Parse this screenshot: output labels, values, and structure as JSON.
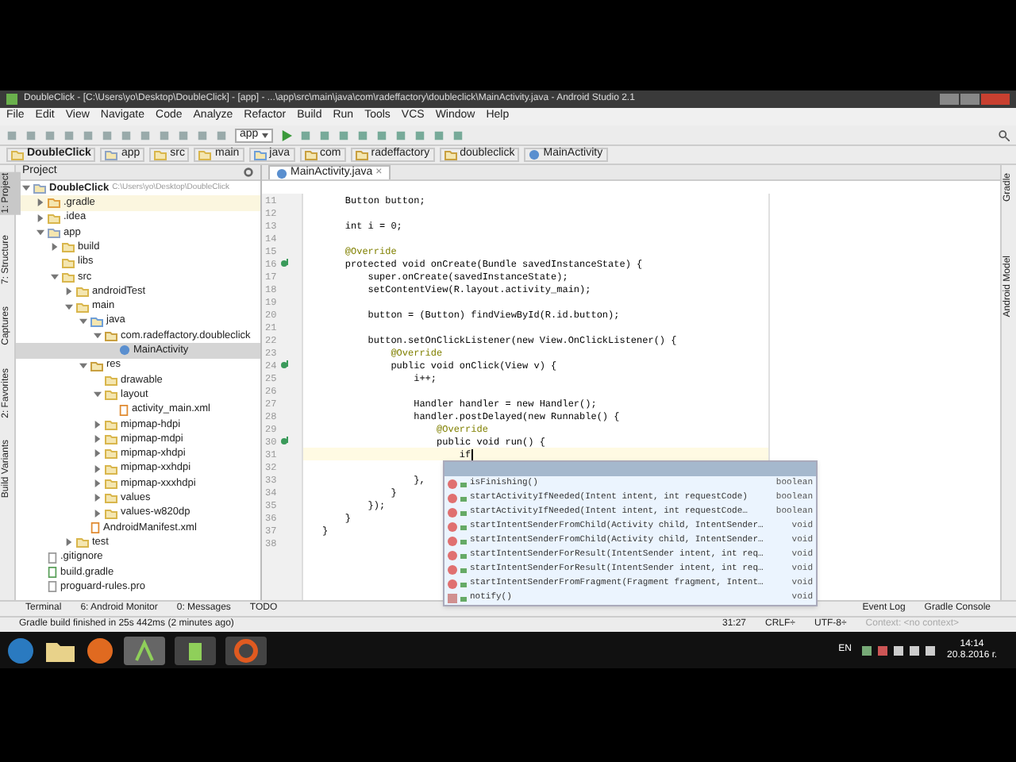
{
  "window": {
    "title": "DoubleClick - [C:\\Users\\yo\\Desktop\\DoubleClick] - [app] - ...\\app\\src\\main\\java\\com\\radeffactory\\doubleclick\\MainActivity.java - Android Studio 2.1"
  },
  "menu": [
    "File",
    "Edit",
    "View",
    "Navigate",
    "Code",
    "Analyze",
    "Refactor",
    "Build",
    "Run",
    "Tools",
    "VCS",
    "Window",
    "Help"
  ],
  "toolbar": {
    "run_config": "app"
  },
  "breadcrumbs": [
    {
      "label": "DoubleClick",
      "kind": "project"
    },
    {
      "label": "app",
      "kind": "module"
    },
    {
      "label": "src",
      "kind": "folder"
    },
    {
      "label": "main",
      "kind": "folder"
    },
    {
      "label": "java",
      "kind": "source"
    },
    {
      "label": "com",
      "kind": "package"
    },
    {
      "label": "radeffactory",
      "kind": "package"
    },
    {
      "label": "doubleclick",
      "kind": "package"
    },
    {
      "label": "MainActivity",
      "kind": "class"
    }
  ],
  "left_tool_tabs": [
    {
      "label": "1: Project",
      "selected": true
    },
    {
      "label": "7: Structure",
      "selected": false
    },
    {
      "label": "Captures",
      "selected": false
    },
    {
      "label": "2: Favorites",
      "selected": false
    },
    {
      "label": "Build Variants",
      "selected": false
    }
  ],
  "right_tool_tabs": [
    {
      "label": "Gradle",
      "selected": false
    },
    {
      "label": "Android Model",
      "selected": false
    }
  ],
  "project_panel": {
    "title": "Project",
    "tree": [
      {
        "label": "DoubleClick",
        "path": "C:\\Users\\yo\\Desktop\\DoubleClick",
        "kind": "module",
        "expanded": true,
        "selected": false,
        "children": [
          {
            "label": ".gradle",
            "kind": "excluded",
            "expanded": false,
            "selected": false
          },
          {
            "label": ".idea",
            "kind": "folder",
            "expanded": false,
            "selected": false
          },
          {
            "label": "app",
            "kind": "module",
            "expanded": true,
            "selected": false,
            "children": [
              {
                "label": "build",
                "kind": "folder",
                "expanded": false,
                "selected": false
              },
              {
                "label": "libs",
                "kind": "folder",
                "selected": false
              },
              {
                "label": "src",
                "kind": "folder",
                "expanded": true,
                "selected": false,
                "children": [
                  {
                    "label": "androidTest",
                    "kind": "folder",
                    "expanded": false,
                    "selected": false
                  },
                  {
                    "label": "main",
                    "kind": "folder",
                    "expanded": true,
                    "selected": false,
                    "children": [
                      {
                        "label": "java",
                        "kind": "source",
                        "expanded": true,
                        "selected": false,
                        "children": [
                          {
                            "label": "com.radeffactory.doubleclick",
                            "kind": "package",
                            "expanded": true,
                            "selected": false,
                            "children": [
                              {
                                "label": "MainActivity",
                                "kind": "class",
                                "selected": true
                              }
                            ]
                          }
                        ]
                      },
                      {
                        "label": "res",
                        "kind": "resources",
                        "expanded": true,
                        "selected": false,
                        "children": [
                          {
                            "label": "drawable",
                            "kind": "folder",
                            "selected": false
                          },
                          {
                            "label": "layout",
                            "kind": "folder",
                            "expanded": true,
                            "selected": false,
                            "children": [
                              {
                                "label": "activity_main.xml",
                                "kind": "xml",
                                "selected": false
                              }
                            ]
                          },
                          {
                            "label": "mipmap-hdpi",
                            "kind": "folder",
                            "expanded": false,
                            "selected": false
                          },
                          {
                            "label": "mipmap-mdpi",
                            "kind": "folder",
                            "expanded": false,
                            "selected": false
                          },
                          {
                            "label": "mipmap-xhdpi",
                            "kind": "folder",
                            "expanded": false,
                            "selected": false
                          },
                          {
                            "label": "mipmap-xxhdpi",
                            "kind": "folder",
                            "expanded": false,
                            "selected": false
                          },
                          {
                            "label": "mipmap-xxxhdpi",
                            "kind": "folder",
                            "expanded": false,
                            "selected": false
                          },
                          {
                            "label": "values",
                            "kind": "folder",
                            "expanded": false,
                            "selected": false
                          },
                          {
                            "label": "values-w820dp",
                            "kind": "folder",
                            "expanded": false,
                            "selected": false
                          }
                        ]
                      },
                      {
                        "label": "AndroidManifest.xml",
                        "kind": "xml",
                        "selected": false
                      }
                    ]
                  },
                  {
                    "label": "test",
                    "kind": "folder",
                    "expanded": false,
                    "selected": false
                  }
                ]
              }
            ]
          },
          {
            "label": ".gitignore",
            "kind": "file",
            "selected": false
          },
          {
            "label": "build.gradle",
            "kind": "gradle",
            "selected": false
          },
          {
            "label": "proguard-rules.pro",
            "kind": "file",
            "selected": false
          }
        ]
      }
    ]
  },
  "editor": {
    "tabs": [
      {
        "label": "MainActivity.java",
        "close": "×",
        "selected": true
      }
    ],
    "lines": [
      {
        "number": "11",
        "text": "    Button button;",
        "kind": "code",
        "override": false,
        "current": false
      },
      {
        "number": "12",
        "override": false,
        "current": false
      },
      {
        "number": "13",
        "text": "    int i = 0;",
        "kind": "code",
        "override": false,
        "current": false
      },
      {
        "number": "14",
        "override": false,
        "current": false
      },
      {
        "number": "15",
        "text": "    @Override",
        "kind": "annotation",
        "override": false,
        "current": false
      },
      {
        "number": "16",
        "text": "    protected void onCreate(Bundle savedInstanceState) {",
        "kind": "code",
        "override": true,
        "current": false
      },
      {
        "number": "17",
        "text": "        super.onCreate(savedInstanceState);",
        "kind": "code",
        "override": false,
        "current": false
      },
      {
        "number": "18",
        "text": "        setContentView(R.layout.activity_main);",
        "kind": "code",
        "override": false,
        "current": false
      },
      {
        "number": "19",
        "override": false,
        "current": false
      },
      {
        "number": "20",
        "text": "        button = (Button) findViewById(R.id.button);",
        "kind": "code",
        "override": false,
        "current": false
      },
      {
        "number": "21",
        "override": false,
        "current": false
      },
      {
        "number": "22",
        "text": "        button.setOnClickListener(new View.OnClickListener() {",
        "kind": "code",
        "override": false,
        "current": false
      },
      {
        "number": "23",
        "text": "            @Override",
        "kind": "annotation",
        "override": false,
        "current": false
      },
      {
        "number": "24",
        "text": "            public void onClick(View v) {",
        "kind": "code",
        "override": true,
        "current": false
      },
      {
        "number": "25",
        "text": "                i++;",
        "kind": "code",
        "override": false,
        "current": false
      },
      {
        "number": "26",
        "override": false,
        "current": false
      },
      {
        "number": "27",
        "text": "                Handler handler = new Handler();",
        "kind": "code",
        "override": false,
        "current": false
      },
      {
        "number": "28",
        "text": "                handler.postDelayed(new Runnable() {",
        "kind": "code",
        "override": false,
        "current": false
      },
      {
        "number": "29",
        "text": "                    @Override",
        "kind": "annotation",
        "override": false,
        "current": false
      },
      {
        "number": "30",
        "text": "                    public void run() {",
        "kind": "code",
        "override": true,
        "current": false
      },
      {
        "number": "31",
        "text": "                        if",
        "kind": "code",
        "override": false,
        "current": true
      },
      {
        "number": "32",
        "override": false,
        "current": false
      },
      {
        "number": "33",
        "text": "                },",
        "kind": "code",
        "override": false,
        "current": false
      },
      {
        "number": "34",
        "text": "            }",
        "kind": "code",
        "override": false,
        "current": false
      },
      {
        "number": "35",
        "text": "        });",
        "kind": "code",
        "override": false,
        "current": false
      },
      {
        "number": "36",
        "text": "    }",
        "kind": "code",
        "override": false,
        "current": false
      },
      {
        "number": "37",
        "text": "}",
        "kind": "code",
        "override": false,
        "current": false
      },
      {
        "number": "38",
        "override": false,
        "current": false
      }
    ],
    "completion": [
      {
        "kind": "blank",
        "selected": true
      },
      {
        "name": "isFinishing()",
        "type": "boolean",
        "kind": "method",
        "selected": false
      },
      {
        "name": "startActivityIfNeeded(Intent intent, int requestCode)",
        "type": "boolean",
        "kind": "method",
        "selected": false
      },
      {
        "name": "startActivityIfNeeded(Intent intent, int requestCode…",
        "type": "boolean",
        "kind": "method",
        "selected": false
      },
      {
        "name": "startIntentSenderFromChild(Activity child, IntentSender…",
        "type": "void",
        "kind": "method",
        "selected": false
      },
      {
        "name": "startIntentSenderFromChild(Activity child, IntentSender…",
        "type": "void",
        "kind": "method",
        "selected": false
      },
      {
        "name": "startIntentSenderForResult(IntentSender intent, int req…",
        "type": "void",
        "kind": "method",
        "selected": false
      },
      {
        "name": "startIntentSenderForResult(IntentSender intent, int req…",
        "type": "void",
        "kind": "method",
        "selected": false
      },
      {
        "name": "startIntentSenderFromFragment(Fragment fragment, Intent…",
        "type": "void",
        "kind": "method",
        "selected": false
      },
      {
        "name": "notify()",
        "type": "void",
        "kind": "final",
        "selected": false
      }
    ]
  },
  "bottom_tool_tabs": {
    "left": [
      "Terminal",
      "6: Android Monitor",
      "0: Messages",
      "TODO"
    ],
    "right": [
      "Event Log",
      "Gradle Console"
    ]
  },
  "status_bar": {
    "message": "Gradle build finished in 25s 442ms (2 minutes ago)",
    "position": "31:27",
    "line_separator": "CRLF÷",
    "encoding": "UTF-8÷",
    "context": "Context: <no context>"
  },
  "taskbar": {
    "language": "EN",
    "time": "14:14",
    "date": "20.8.2016 г."
  }
}
